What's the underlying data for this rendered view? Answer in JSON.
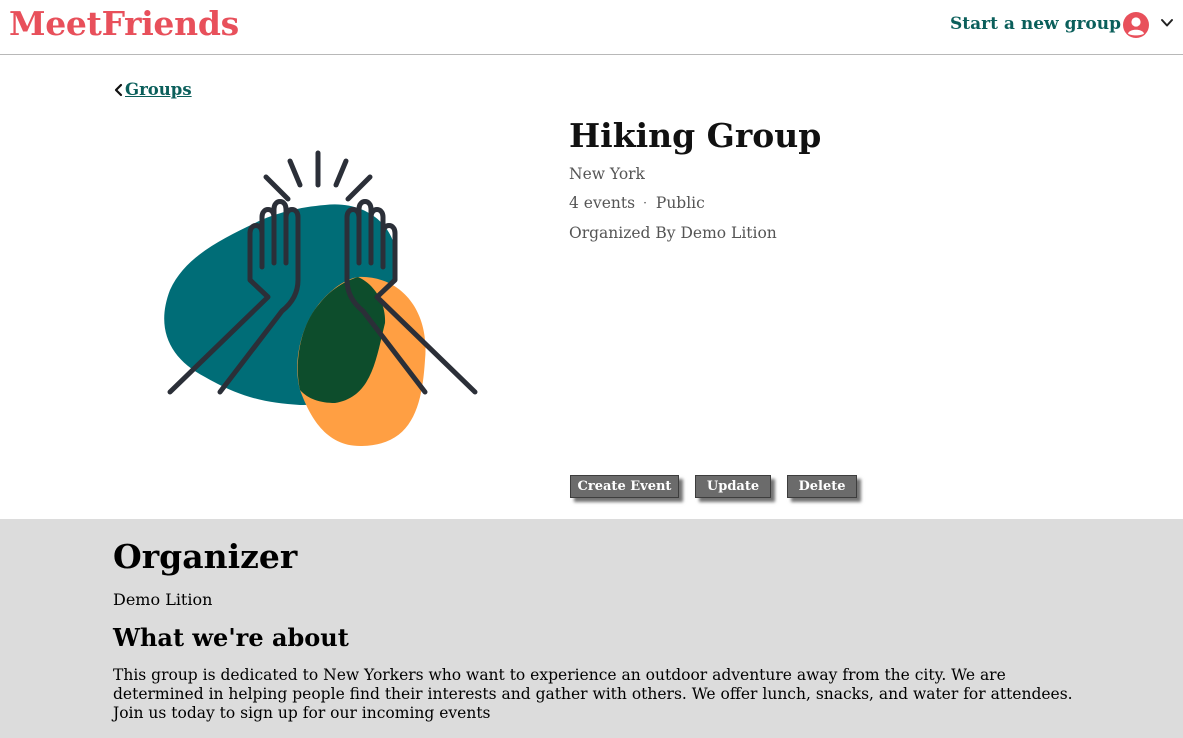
{
  "header": {
    "logo": "MeetFriends",
    "start_group_label": "Start a new group",
    "avatar_icon": "user-circle-icon",
    "menu_icon": "chevron-down-icon"
  },
  "breadcrumb": {
    "back_icon": "chevron-left-icon",
    "label": "Groups"
  },
  "group": {
    "title": "Hiking Group",
    "location": "New York",
    "events": "4 events",
    "separator": "·",
    "privacy": "Public",
    "organized_by": "Organized By Demo Lition",
    "image": "high-five-illustration"
  },
  "actions": {
    "create_event": "Create Event",
    "update": "Update",
    "delete": "Delete"
  },
  "organizer": {
    "heading": "Organizer",
    "name": "Demo Lition"
  },
  "about": {
    "heading": "What we're about",
    "text": "This group is dedicated to New Yorkers who want to experience an outdoor adventure away from the city. We are determined in helping people find their interests and gather with others. We offer lunch, snacks, and water for attendees. Join us today to sign up for our incoming events"
  },
  "colors": {
    "brand": "#e8505b",
    "accent": "#0b5f5b",
    "button": "#6b6b6b",
    "section_bg": "#dcdcdc",
    "blob_teal": "#006d77",
    "blob_orange": "#ff9f43",
    "blob_overlap": "#0d4d2c"
  }
}
